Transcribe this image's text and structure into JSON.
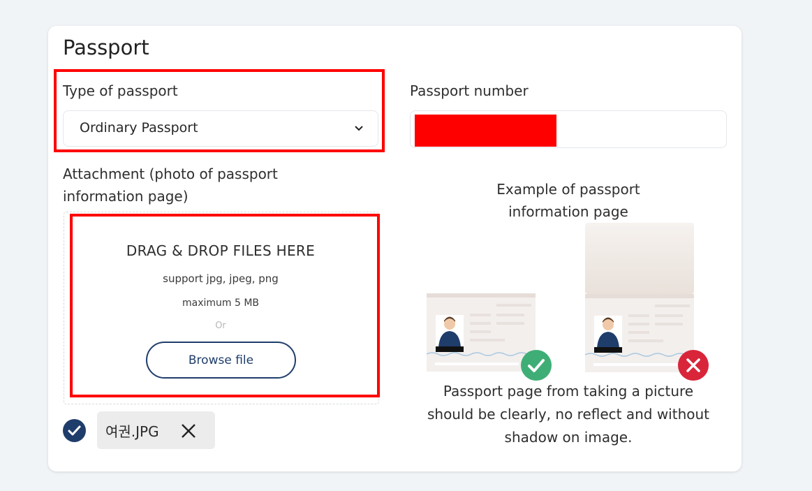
{
  "section": {
    "title": "Passport"
  },
  "passport_type": {
    "label": "Type of passport",
    "selected": "Ordinary Passport"
  },
  "passport_number": {
    "label": "Passport number",
    "value_redacted": true
  },
  "attachment": {
    "label_line1": "Attachment (photo of passport",
    "label_line2": "information page)",
    "dropzone_title": "DRAG & DROP FILES HERE",
    "support_text": "support jpg, jpeg, png",
    "max_text": "maximum 5 MB",
    "or_text": "Or",
    "browse_label": "Browse file"
  },
  "uploaded_file": {
    "name": "여권.JPG"
  },
  "example": {
    "title_line1": "Example of passport",
    "title_line2": "information page",
    "caption_line1": "Passport page from taking a picture",
    "caption_line2": "should be clearly, no reflect and without",
    "caption_line3": "shadow on image.",
    "good_icon": "check-icon",
    "bad_icon": "cross-icon"
  },
  "colors": {
    "accent": "#1f3d6b",
    "highlight": "#ff0000",
    "good": "#3fae76",
    "bad": "#d9253a"
  }
}
